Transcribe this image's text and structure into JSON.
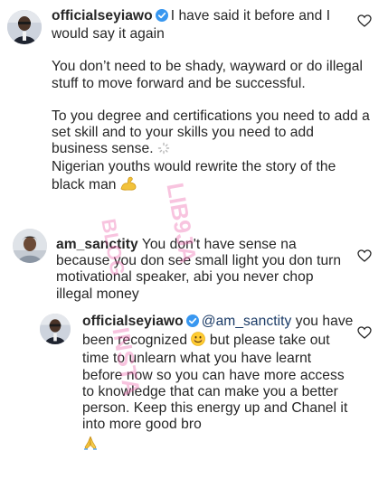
{
  "comments": [
    {
      "username": "officialseyiawo",
      "paragraphs": [
        "I have said it before and I would say it again",
        "You don’t need to be shady, wayward or do illegal stuff to move forward and be successful.",
        "To you degree and certifications you need to add a set skill and to your skills you need to add business sense.",
        "Nigerian youths would rewrite the story of the black man"
      ]
    },
    {
      "username": "am_sanctity",
      "text": "You don't have sense na because you don see small light you don turn motivational speaker, abi you never chop illegal money"
    },
    {
      "username": "officialseyiawo",
      "mention": "@am_sanctity",
      "text_before_emoji": "you have been recognized",
      "text_after_emoji": "but please take out time to unlearn what you have learnt before now so you can have more access to knowledge that can make you a better person. Keep this energy up and Chanel it into more good bro"
    }
  ],
  "watermark": {
    "text_top": "LIB9JA",
    "text_mid": "BLOG",
    "text_bot": "INSTA"
  },
  "icons": {
    "verified": "verified-badge-icon",
    "heart": "heart-outline-icon",
    "spinner": "loading-spinner-icon",
    "muscle": "flexed-biceps-emoji",
    "smile": "smiling-face-emoji",
    "pray": "folded-hands-emoji"
  },
  "colors": {
    "verified_blue": "#3897f0",
    "watermark_pink": "#ec64aa",
    "mention": "#1a3a66"
  }
}
